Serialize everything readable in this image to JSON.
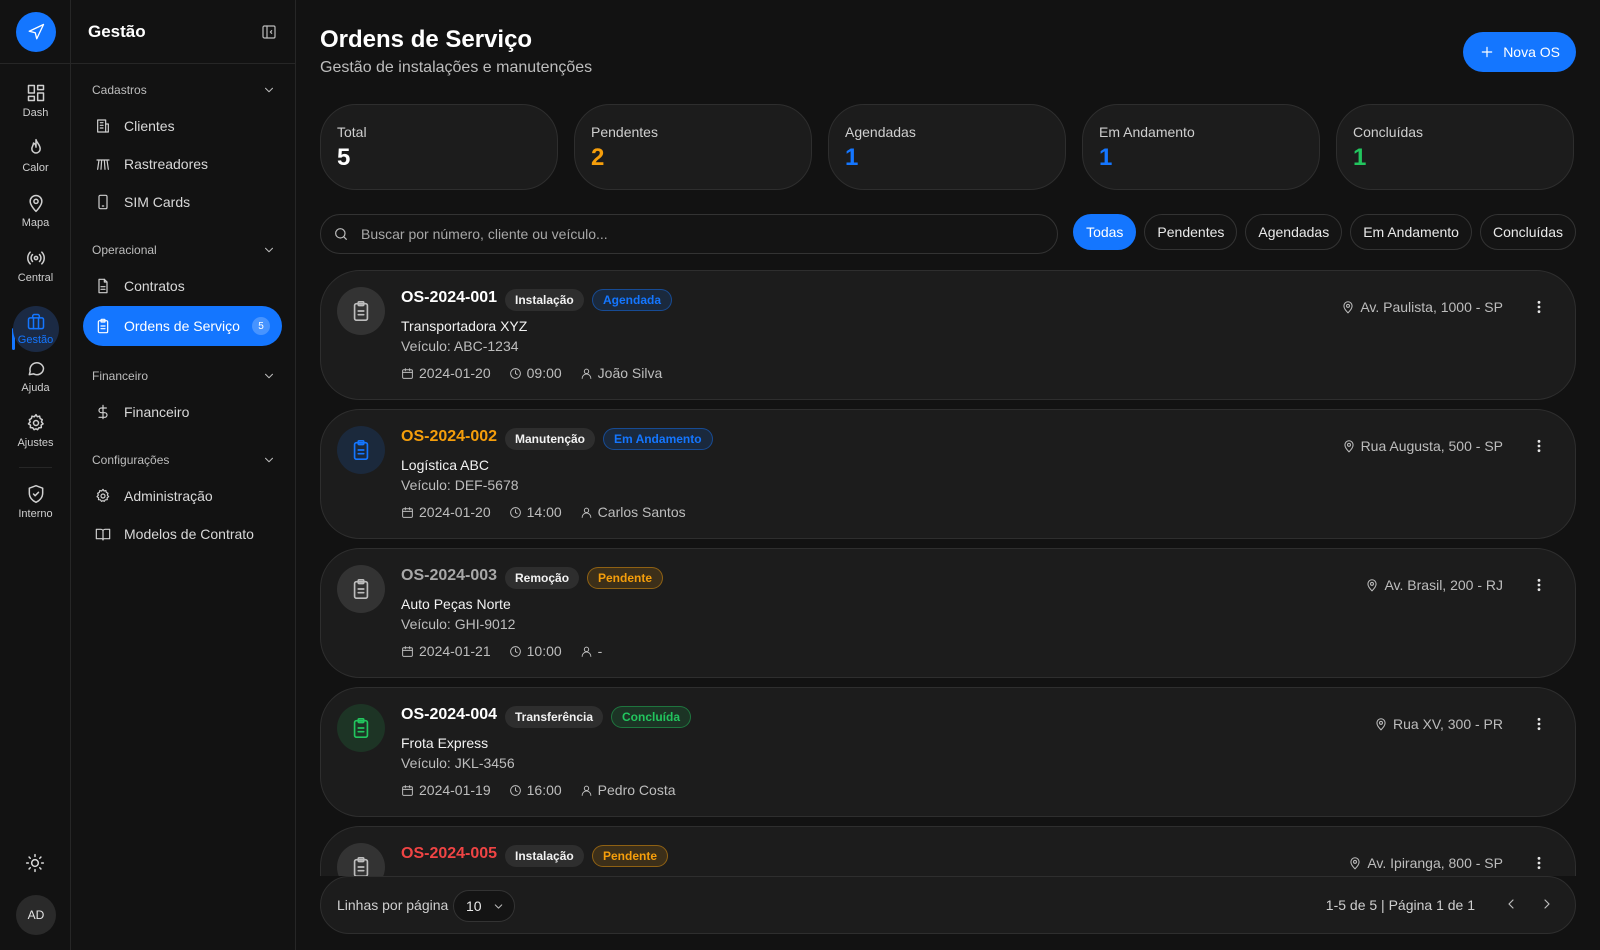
{
  "rail": {
    "logo_icon": "navigation-icon",
    "items": [
      {
        "label": "Dash",
        "icon": "dashboard-icon"
      },
      {
        "label": "Calor",
        "icon": "flame-icon"
      },
      {
        "label": "Mapa",
        "icon": "map-pin-icon"
      },
      {
        "label": "Central",
        "icon": "radio-icon"
      },
      {
        "label": "Gestão",
        "icon": "briefcase-icon",
        "active": true
      },
      {
        "label": "Ajuda",
        "icon": "chat-icon"
      },
      {
        "label": "Ajustes",
        "icon": "gear-icon"
      },
      {
        "label": "Interno",
        "icon": "shield-check-icon"
      }
    ],
    "avatar": "AD"
  },
  "sidebar": {
    "title": "Gestão",
    "groups": [
      {
        "label": "Cadastros",
        "items": [
          {
            "label": "Clientes",
            "icon": "building-icon"
          },
          {
            "label": "Rastreadores",
            "icon": "antenna-icon"
          },
          {
            "label": "SIM Cards",
            "icon": "smartphone-icon"
          }
        ]
      },
      {
        "label": "Operacional",
        "items": [
          {
            "label": "Contratos",
            "icon": "file-text-icon"
          },
          {
            "label": "Ordens de Serviço",
            "icon": "clipboard-icon",
            "active": true,
            "badge": "5"
          }
        ]
      },
      {
        "label": "Financeiro",
        "items": [
          {
            "label": "Financeiro",
            "icon": "dollar-icon"
          }
        ]
      },
      {
        "label": "Configurações",
        "items": [
          {
            "label": "Administração",
            "icon": "gear-icon"
          },
          {
            "label": "Modelos de Contrato",
            "icon": "book-icon"
          }
        ]
      }
    ]
  },
  "header": {
    "title": "Ordens de Serviço",
    "subtitle": "Gestão de instalações e manutenções",
    "new_button": "Nova OS"
  },
  "stats": [
    {
      "label": "Total",
      "value": "5",
      "color": "#ffffff"
    },
    {
      "label": "Pendentes",
      "value": "2",
      "color": "#f59e0b"
    },
    {
      "label": "Agendadas",
      "value": "1",
      "color": "#1476ff"
    },
    {
      "label": "Em Andamento",
      "value": "1",
      "color": "#1476ff"
    },
    {
      "label": "Concluídas",
      "value": "1",
      "color": "#22c55e"
    }
  ],
  "search": {
    "placeholder": "Buscar por número, cliente ou veículo...",
    "value": ""
  },
  "filters": [
    {
      "label": "Todas",
      "active": true
    },
    {
      "label": "Pendentes"
    },
    {
      "label": "Agendadas"
    },
    {
      "label": "Em Andamento"
    },
    {
      "label": "Concluídas"
    }
  ],
  "orders": [
    {
      "id": "OS-2024-001",
      "id_color": "#ffffff",
      "type": "Instalação",
      "status": "Agendada",
      "status_color": "#1476ff",
      "client": "Transportadora XYZ",
      "vehicle": "Veículo: ABC-1234",
      "date": "2024-01-20",
      "time": "09:00",
      "tech": "João Silva",
      "location": "Av. Paulista, 1000 - SP",
      "icon_color": "#bdbdbd"
    },
    {
      "id": "OS-2024-002",
      "id_color": "#f59e0b",
      "type": "Manutenção",
      "status": "Em Andamento",
      "status_color": "#1476ff",
      "client": "Logística ABC",
      "vehicle": "Veículo: DEF-5678",
      "date": "2024-01-20",
      "time": "14:00",
      "tech": "Carlos Santos",
      "location": "Rua Augusta, 500 - SP",
      "icon_color": "#1476ff"
    },
    {
      "id": "OS-2024-003",
      "id_color": "#a8a8a8",
      "type": "Remoção",
      "status": "Pendente",
      "status_color": "#f59e0b",
      "client": "Auto Peças Norte",
      "vehicle": "Veículo: GHI-9012",
      "date": "2024-01-21",
      "time": "10:00",
      "tech": "-",
      "location": "Av. Brasil, 200 - RJ",
      "icon_color": "#bdbdbd"
    },
    {
      "id": "OS-2024-004",
      "id_color": "#ffffff",
      "type": "Transferência",
      "status": "Concluída",
      "status_color": "#22c55e",
      "client": "Frota Express",
      "vehicle": "Veículo: JKL-3456",
      "date": "2024-01-19",
      "time": "16:00",
      "tech": "Pedro Costa",
      "location": "Rua XV, 300 - PR",
      "icon_color": "#22c55e"
    },
    {
      "id": "OS-2024-005",
      "id_color": "#ef4444",
      "type": "Instalação",
      "status": "Pendente",
      "status_color": "#f59e0b",
      "client": "",
      "vehicle": "",
      "date": "",
      "time": "",
      "tech": "",
      "location": "Av. Ipiranga, 800 - SP",
      "icon_color": "#bdbdbd"
    }
  ],
  "footer": {
    "rows_label": "Linhas por página",
    "rows_value": "10",
    "range": "1-5 de 5 | Página 1 de 1"
  }
}
